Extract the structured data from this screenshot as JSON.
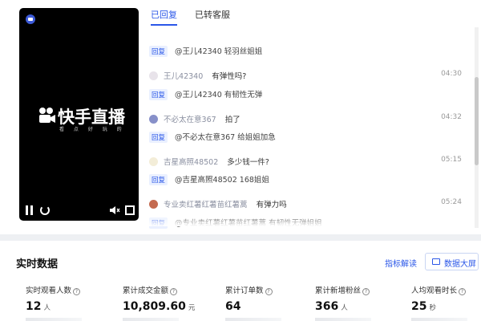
{
  "video": {
    "brand_name": "快手直播",
    "brand_sub": "看 点 好 玩 的"
  },
  "tabs": [
    {
      "label": "已回复",
      "active": true
    },
    {
      "label": "已转客服",
      "active": false
    }
  ],
  "comments": [
    {
      "kind": "reply",
      "text": "@王儿42340 轻羽丝姐姐"
    },
    {
      "kind": "comment",
      "user": "王儿42340",
      "message": "有弹性吗?",
      "time": "04:30",
      "avatar_color": "#e8e3ea"
    },
    {
      "kind": "reply",
      "text": "@王儿42340 有韧性无弹"
    },
    {
      "kind": "comment",
      "user": "不必太在意367",
      "message": "拍了",
      "time": "04:32",
      "avatar_color": "#8790c9"
    },
    {
      "kind": "reply",
      "text": "@不必太在意367 给姐姐加急"
    },
    {
      "kind": "comment",
      "user": "吉星高照48502",
      "message": "多少钱一件?",
      "time": "05:15",
      "avatar_color": "#f3edd8"
    },
    {
      "kind": "reply",
      "text": "@吉星高照48502 168姐姐"
    },
    {
      "kind": "comment",
      "user": "专业卖红薯红薯苗红薯蒿",
      "message": "有弹力吗",
      "time": "05:24",
      "avatar_color": "#c46a4f"
    },
    {
      "kind": "reply",
      "text": "@专业卖红薯红薯苗红薯蒿 有韧性无弹姐姐"
    }
  ],
  "realtime": {
    "title": "实时数据",
    "guide_link": "指标解读",
    "big_screen_button": "数据大屏",
    "metrics": [
      {
        "label": "实时观看人数",
        "value": "12",
        "unit": "人"
      },
      {
        "label": "累计成交金额",
        "value": "10,809.60",
        "unit": "元"
      },
      {
        "label": "累计订单数",
        "value": "64",
        "unit": ""
      },
      {
        "label": "累计新增粉丝",
        "value": "366",
        "unit": "人"
      },
      {
        "label": "人均观看时长",
        "value": "25",
        "unit": "秒"
      }
    ]
  }
}
